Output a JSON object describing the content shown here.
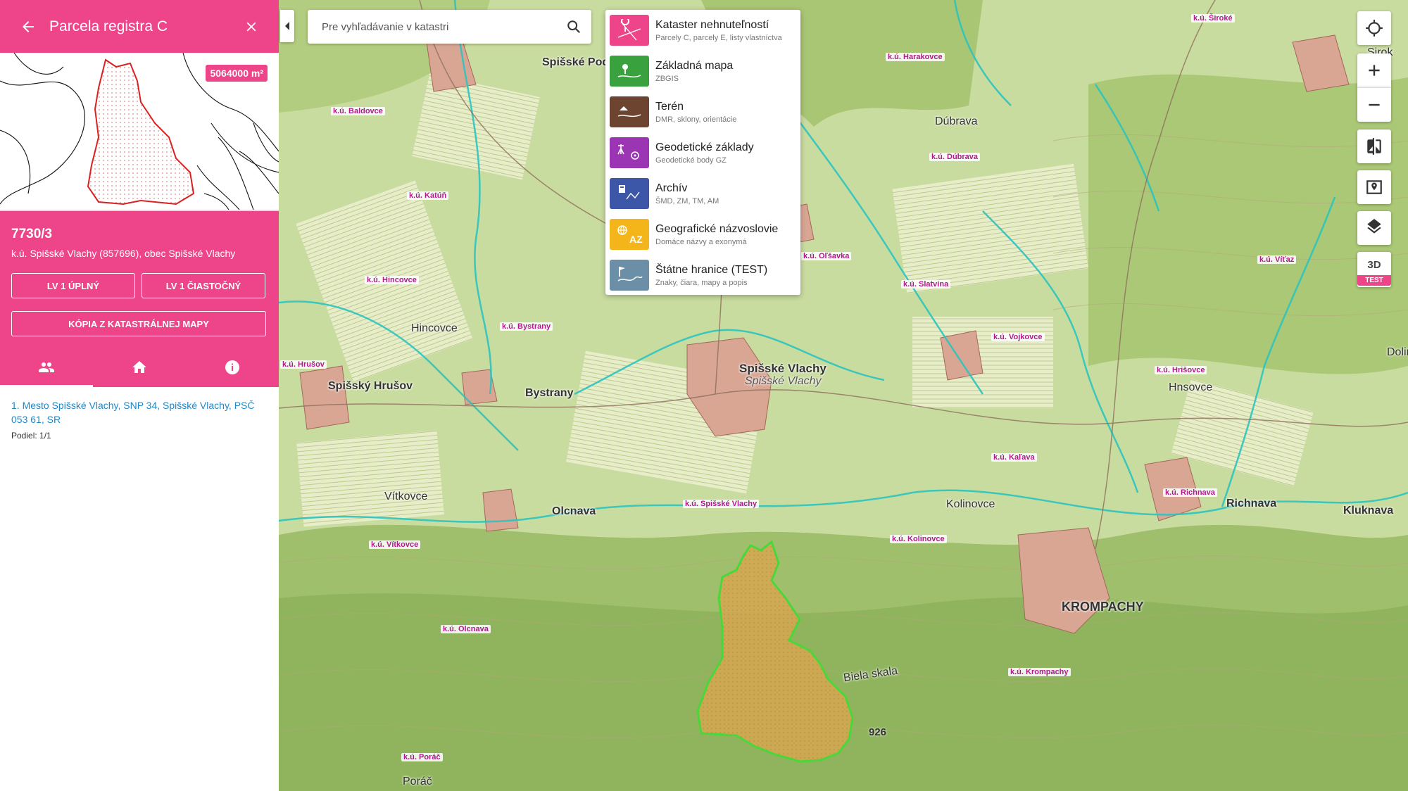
{
  "panel": {
    "title": "Parcela registra C",
    "area_badge": "5064000 m²",
    "parcel_number": "7730/3",
    "location": "k.ú. Spišské Vlachy (857696), obec Spišské Vlachy",
    "buttons": {
      "lv_full": "LV 1 ÚPLNÝ",
      "lv_partial": "LV 1 ČIASTOČNÝ",
      "map_copy": "KÓPIA Z KATASTRÁLNEJ MAPY"
    },
    "owner": {
      "line": "1. Mesto Spišské Vlachy, SNP 34, Spišské Vlachy, PSČ 053 61, SR",
      "share": "Podiel: 1/1"
    }
  },
  "search": {
    "placeholder": "Pre vyhľadávanie v katastri"
  },
  "layers": [
    {
      "name": "Kataster nehnuteľností",
      "sub": "Parcely C, parcely E, listy vlastníctva",
      "color": "#ee4489",
      "icon": "cadastre-icon"
    },
    {
      "name": "Základná mapa",
      "sub": "ZBGIS",
      "color": "#3aa13f",
      "icon": "base-map-icon"
    },
    {
      "name": "Terén",
      "sub": "DMR, sklony, orientácie",
      "color": "#6d4430",
      "icon": "terrain-icon"
    },
    {
      "name": "Geodetické základy",
      "sub": "Geodetické body GZ",
      "color": "#9b35b4",
      "icon": "geodetic-icon"
    },
    {
      "name": "Archív",
      "sub": "ŠMD, ZM, TM, AM",
      "color": "#3d57a8",
      "icon": "archive-icon"
    },
    {
      "name": "Geografické názvoslovie",
      "sub": "Domáce názvy a exonymá",
      "color": "#f3b51a",
      "icon": "names-icon"
    },
    {
      "name": "Štátne hranice (TEST)",
      "sub": "Znaky, čiara, mapy a popis",
      "color": "#6b8fa6",
      "icon": "border-icon"
    }
  ],
  "controls": {
    "btn3d": "3D",
    "test": "TEST"
  },
  "map": {
    "towns": [
      {
        "name": "Spišské Vlachy"
      },
      {
        "name": "Spišské Vlachy"
      },
      {
        "name": "Bystrany"
      },
      {
        "name": "Spišský Hrušov"
      },
      {
        "name": "Olcnava"
      },
      {
        "name": "KROMPACHY"
      },
      {
        "name": "Richnava"
      },
      {
        "name": "Kluknava"
      },
      {
        "name": "Spišské Podhradie"
      },
      {
        "name": "Hincovce"
      },
      {
        "name": "Vítkovce"
      },
      {
        "name": "Kolinovce"
      },
      {
        "name": "Dúbrava"
      },
      {
        "name": "Hnsovce"
      },
      {
        "name": "Poráč"
      },
      {
        "name": "Biela skala"
      },
      {
        "name": "Sirok"
      },
      {
        "name": "Dolin"
      }
    ],
    "ku": [
      {
        "name": "k.ú. Baldovce"
      },
      {
        "name": "k.ú. Katúň"
      },
      {
        "name": "k.ú. Hincovce"
      },
      {
        "name": "k.ú. Bystrany"
      },
      {
        "name": "k.ú. Hrušov"
      },
      {
        "name": "k.ú. Vítkovce"
      },
      {
        "name": "k.ú. Olcnava"
      },
      {
        "name": "k.ú. Spišské Vlachy"
      },
      {
        "name": "k.ú. Kolinovce"
      },
      {
        "name": "k.ú. Krompachy"
      },
      {
        "name": "k.ú. Kaľava"
      },
      {
        "name": "k.ú. Richnava"
      },
      {
        "name": "k.ú. Hrišovce"
      },
      {
        "name": "k.ú. Vojkovce"
      },
      {
        "name": "k.ú. Slatvina"
      },
      {
        "name": "k.ú. Oľšavka"
      },
      {
        "name": "k.ú. Dúbrava"
      },
      {
        "name": "k.ú. Harakovce"
      },
      {
        "name": "k.ú. Široké"
      },
      {
        "name": "k.ú. Víťaz"
      },
      {
        "name": "k.ú. Poráč"
      }
    ],
    "elevation": "926"
  }
}
